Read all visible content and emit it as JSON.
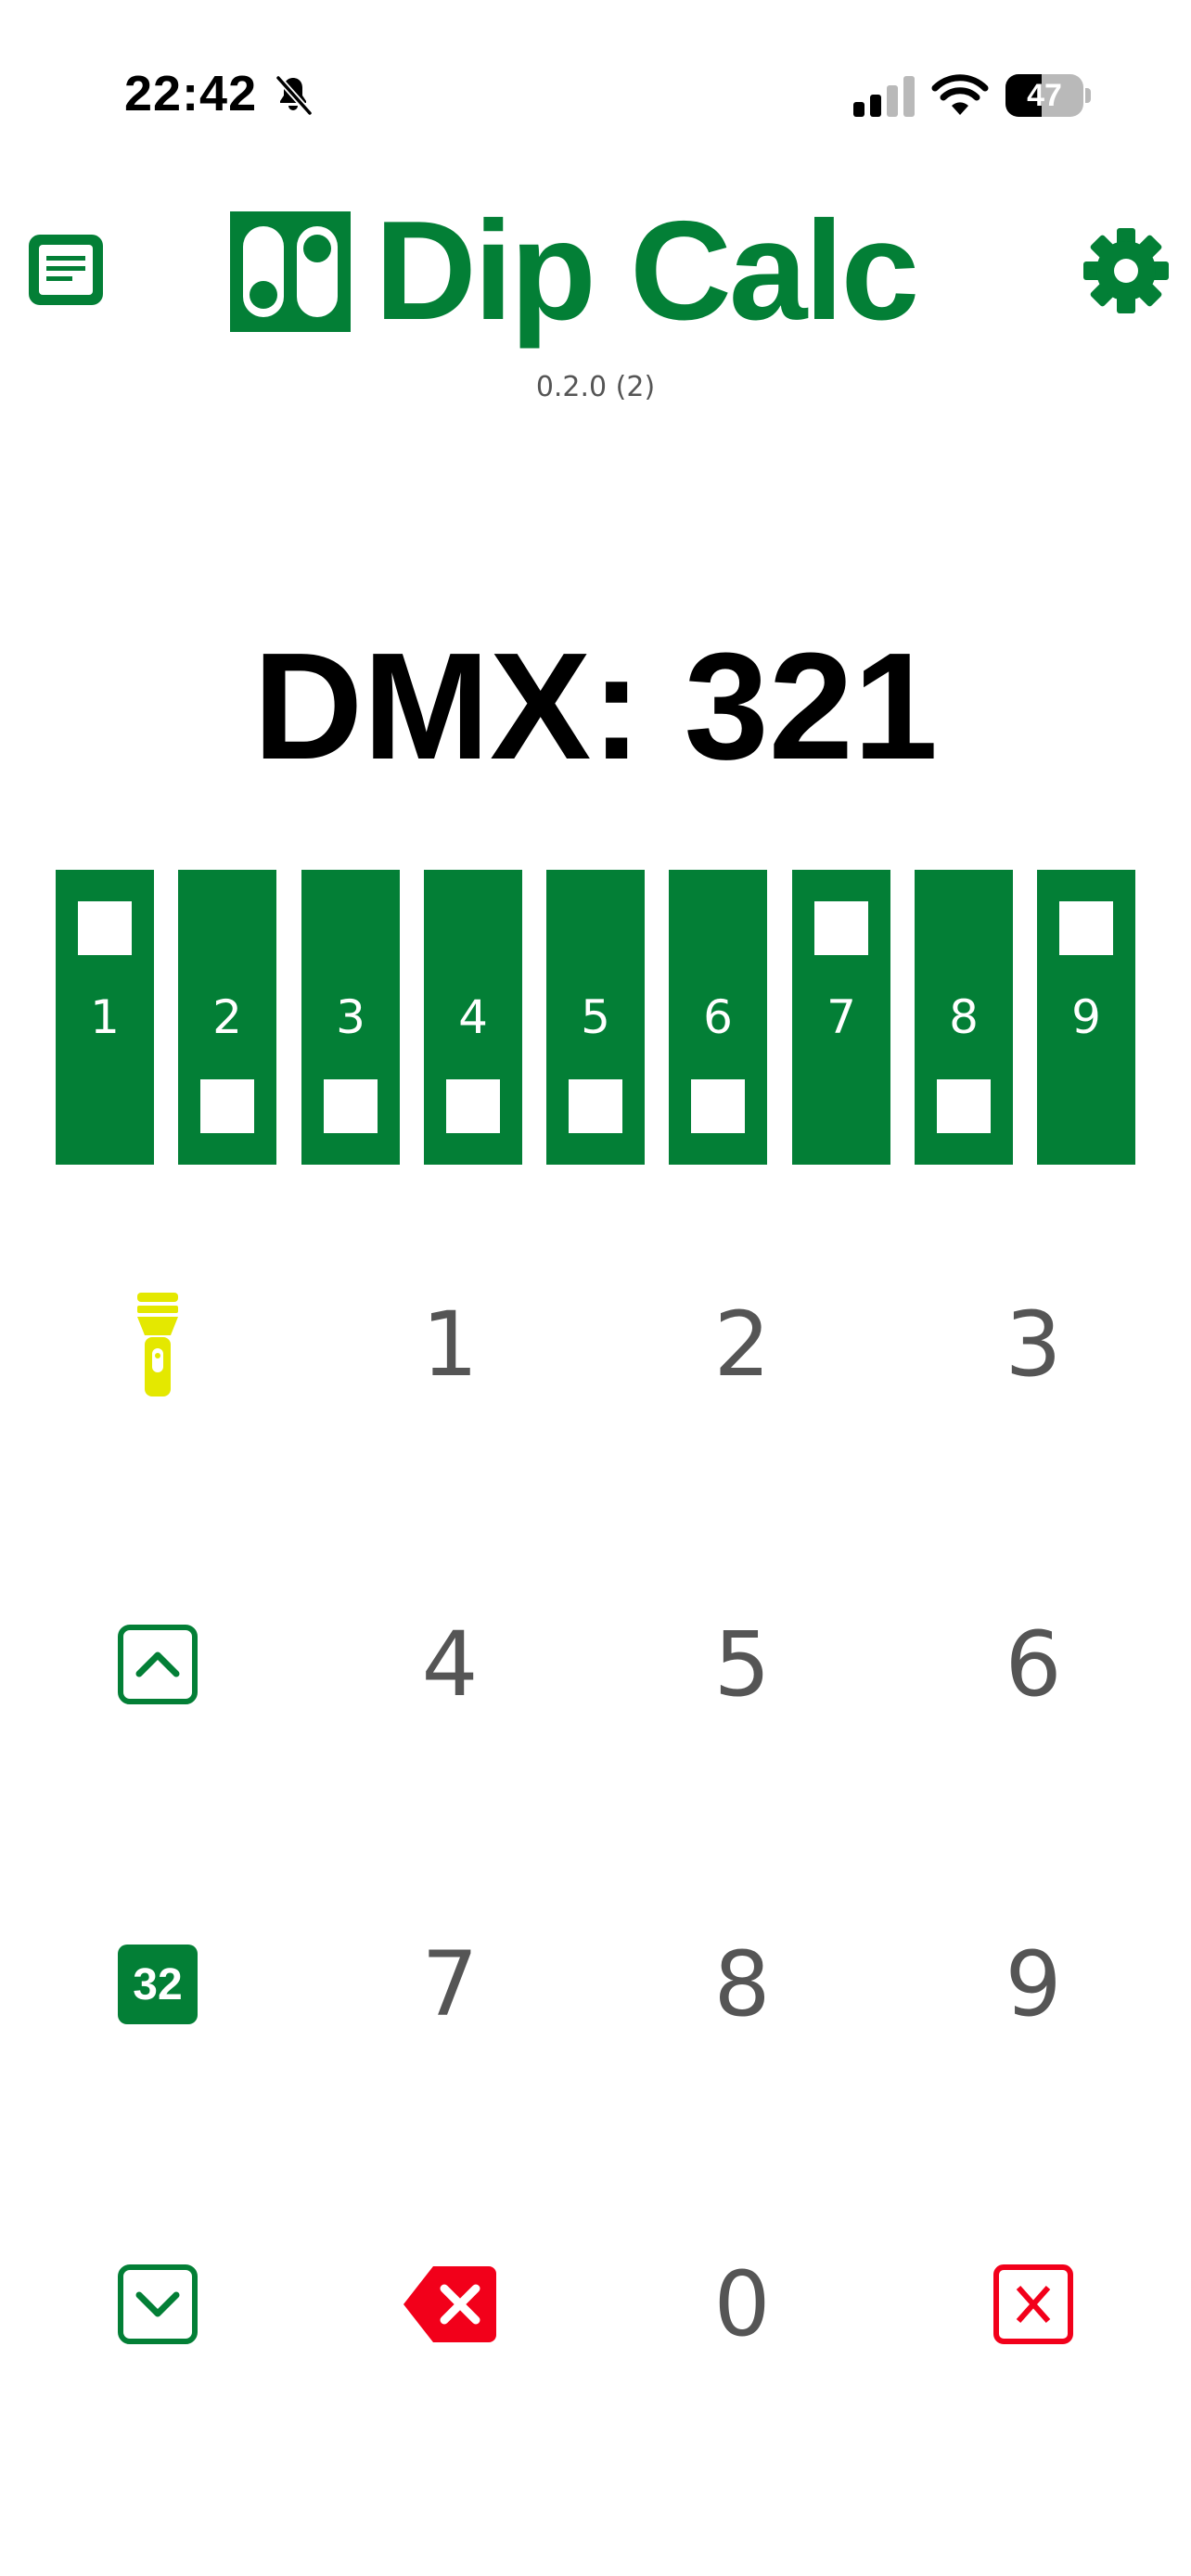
{
  "status_bar": {
    "time": "22:42",
    "battery_percent": 47,
    "battery_label": "47",
    "signal_bars_active": 2,
    "signal_bars_total": 4,
    "icons": [
      "bell-slash-icon",
      "cellular-signal-icon",
      "wifi-icon",
      "battery-icon"
    ]
  },
  "header": {
    "title": "Dip Calc",
    "version": "0.2.0 (2)",
    "left_icon": "notes-icon",
    "right_icon": "gear-icon",
    "logo_icon": "dip-switch-logo-icon"
  },
  "dmx": {
    "label": "DMX:",
    "value": "321",
    "display": "DMX: 321"
  },
  "dip_switches": [
    {
      "number": "1",
      "on": true
    },
    {
      "number": "2",
      "on": false
    },
    {
      "number": "3",
      "on": false
    },
    {
      "number": "4",
      "on": false
    },
    {
      "number": "5",
      "on": false
    },
    {
      "number": "6",
      "on": false
    },
    {
      "number": "7",
      "on": true
    },
    {
      "number": "8",
      "on": false
    },
    {
      "number": "9",
      "on": true
    }
  ],
  "keypad": {
    "digits": [
      "1",
      "2",
      "3",
      "4",
      "5",
      "6",
      "7",
      "8",
      "9",
      "0"
    ],
    "increment_icon": "chevron-up-square-icon",
    "decrement_icon": "chevron-down-square-icon",
    "flashlight_icon": "flashlight-icon",
    "channels_badge": "32",
    "backspace_icon": "backspace-icon",
    "clear_icon": "clear-x-square-icon"
  },
  "colors": {
    "brand_green": "#037f36",
    "flashlight_yellow": "#e4e800",
    "danger_red": "#f2001a",
    "digit_gray": "#555555"
  }
}
